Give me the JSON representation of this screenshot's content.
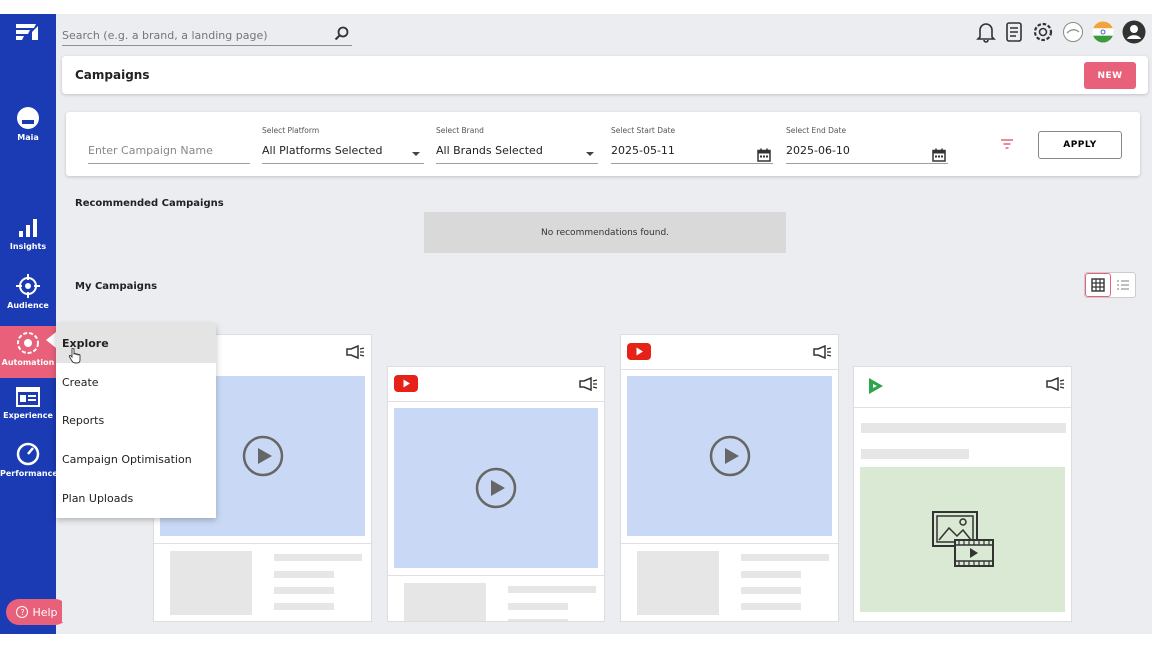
{
  "search": {
    "placeholder": "Search (e.g. a brand, a landing page)"
  },
  "sidebar": {
    "items": [
      {
        "label": "Maia",
        "icon": "maia-icon"
      },
      {
        "label": "Insights",
        "icon": "bar-chart-icon"
      },
      {
        "label": "Audience",
        "icon": "target-icon"
      },
      {
        "label": "Automation",
        "icon": "gear-icon"
      },
      {
        "label": "Experience",
        "icon": "browser-icon"
      },
      {
        "label": "Performance",
        "icon": "gauge-icon"
      }
    ],
    "help_label": "Help"
  },
  "header": {
    "title": "Campaigns",
    "new_label": "NEW"
  },
  "filters": {
    "campaign_name_placeholder": "Enter Campaign Name",
    "platform": {
      "caption": "Select Platform",
      "value": "All Platforms Selected"
    },
    "brand": {
      "caption": "Select Brand",
      "value": "All Brands Selected"
    },
    "start_date": {
      "caption": "Select Start Date",
      "value": "2025-05-11"
    },
    "end_date": {
      "caption": "Select End Date",
      "value": "2025-06-10"
    },
    "apply_label": "APPLY"
  },
  "recommended": {
    "title": "Recommended Campaigns",
    "empty_text": "No recommendations found."
  },
  "my_campaigns": {
    "title": "My Campaigns"
  },
  "automation_menu": {
    "items": [
      "Explore",
      "Create",
      "Reports",
      "Campaign Optimisation",
      "Plan Uploads"
    ],
    "highlighted": "Explore"
  },
  "colors": {
    "sidebar": "#1a3bb3",
    "accent": "#e8607a",
    "youtube": "#e62117",
    "thumb_blue": "#c9d9f5",
    "thumb_green": "#d9e9d3"
  }
}
